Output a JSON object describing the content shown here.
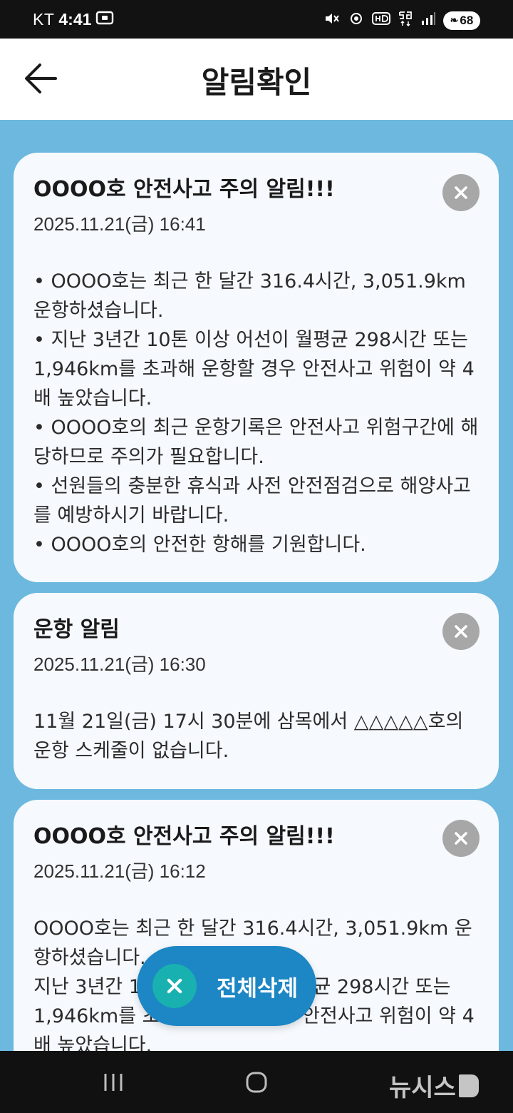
{
  "status_bar": {
    "carrier": "KT",
    "time": "4:41",
    "battery": "68"
  },
  "header": {
    "title": "알림확인"
  },
  "notifications": [
    {
      "title": "OOOO호 안전사고 주의 알림!!!",
      "datetime": "2025.11.21(금) 16:41",
      "body": "• OOOO호는 최근 한 달간 316.4시간, 3,051.9km 운항하셨습니다.\n• 지난 3년간 10톤 이상 어선이 월평균 298시간 또는 1,946km를 초과해 운항할 경우 안전사고 위험이 약 4배 높았습니다.\n• OOOO호의 최근 운항기록은 안전사고 위험구간에 해당하므로 주의가 필요합니다.\n• 선원들의 충분한 휴식과 사전 안전점검으로 해양사고를 예방하시기 바랍니다.\n• OOOO호의 안전한 항해를 기원합니다."
    },
    {
      "title": "운항 알림",
      "datetime": "2025.11.21(금) 16:30",
      "body": "11월 21일(금) 17시 30분에 삼목에서 △△△△△호의 운항 스케줄이 없습니다."
    },
    {
      "title": "OOOO호 안전사고 주의 알림!!!",
      "datetime": "2025.11.21(금) 16:12",
      "body": "OOOO호는 최근 한 달간 316.4시간, 3,051.9km 운항하셨습니다.\n지난 3년간 10톤 이상 어선이 월평균 298시간 또는 1,946km를 초과해 운항할 경우 안전사고 위험이 약 4배 높았습니다."
    }
  ],
  "fab": {
    "label": "전체삭제"
  },
  "watermark": {
    "text": "뉴시스"
  }
}
